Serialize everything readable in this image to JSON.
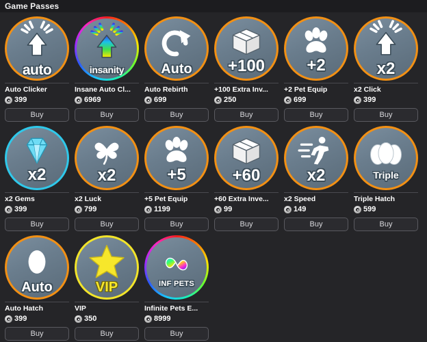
{
  "header": {
    "title": "Game Passes"
  },
  "labels": {
    "buy": "Buy"
  },
  "colors": {
    "background": "#252528",
    "header_bar": "#1c1c1f",
    "ring_orange": "#f29014",
    "ring_cyan": "#2fc8ea",
    "ring_yellow": "#f2e42a",
    "ring_rainbow": "rainbow",
    "badge_disc": "#6a7d8d",
    "text_primary": "#ffffff",
    "button_text": "#d8d8dc",
    "divider": "#4a4a50"
  },
  "passes": [
    {
      "name": "Auto Clicker",
      "price": "399",
      "ring": "orange",
      "icon": "cursor-arrow-icon",
      "glyph": "auto",
      "glyph_style": "script",
      "buy": "Buy"
    },
    {
      "name": "Insane Auto Cl...",
      "price": "6969",
      "ring": "rainbow",
      "icon": "cursor-arrow-rainbow-icon",
      "glyph": "insanity",
      "glyph_style": "script-small",
      "buy": "Buy"
    },
    {
      "name": "Auto Rebirth",
      "price": "699",
      "ring": "orange",
      "icon": "rebirth-arrow-icon",
      "glyph": "Auto",
      "glyph_style": "med",
      "buy": "Buy"
    },
    {
      "name": "+100 Extra Inv...",
      "price": "250",
      "ring": "orange",
      "icon": "box-icon",
      "glyph": "+100",
      "glyph_style": "big",
      "buy": "Buy"
    },
    {
      "name": "+2 Pet Equip",
      "price": "699",
      "ring": "orange",
      "icon": "paw-icon",
      "glyph": "+2",
      "glyph_style": "big",
      "buy": "Buy"
    },
    {
      "name": "x2 Click",
      "price": "399",
      "ring": "orange",
      "icon": "cursor-arrow-icon",
      "glyph": "x2",
      "glyph_style": "big",
      "buy": "Buy"
    },
    {
      "name": "x2 Gems",
      "price": "399",
      "ring": "cyan",
      "icon": "gem-icon",
      "glyph": "x2",
      "glyph_style": "big",
      "buy": "Buy"
    },
    {
      "name": "x2 Luck",
      "price": "799",
      "ring": "orange",
      "icon": "clover-icon",
      "glyph": "x2",
      "glyph_style": "big",
      "buy": "Buy"
    },
    {
      "name": "+5 Pet Equip",
      "price": "1199",
      "ring": "orange",
      "icon": "paw-icon",
      "glyph": "+5",
      "glyph_style": "big",
      "buy": "Buy"
    },
    {
      "name": "+60 Extra Inve...",
      "price": "99",
      "ring": "orange",
      "icon": "box-icon",
      "glyph": "+60",
      "glyph_style": "big",
      "buy": "Buy"
    },
    {
      "name": "x2 Speed",
      "price": "149",
      "ring": "orange",
      "icon": "runner-icon",
      "glyph": "x2",
      "glyph_style": "big",
      "buy": "Buy"
    },
    {
      "name": "Triple Hatch",
      "price": "599",
      "ring": "orange",
      "icon": "triple-egg-icon",
      "glyph": "Triple",
      "glyph_style": "small",
      "buy": "Buy"
    },
    {
      "name": "Auto Hatch",
      "price": "399",
      "ring": "orange",
      "icon": "egg-icon",
      "glyph": "Auto",
      "glyph_style": "med",
      "buy": "Buy"
    },
    {
      "name": "VIP",
      "price": "350",
      "ring": "yellow",
      "icon": "star-icon",
      "glyph": "VIP",
      "glyph_style": "yellow",
      "buy": "Buy"
    },
    {
      "name": "Infinite Pets E...",
      "price": "8999",
      "ring": "rainbow",
      "icon": "infinity-icon",
      "glyph": "INF PETS",
      "glyph_style": "tiny",
      "buy": "Buy"
    }
  ]
}
